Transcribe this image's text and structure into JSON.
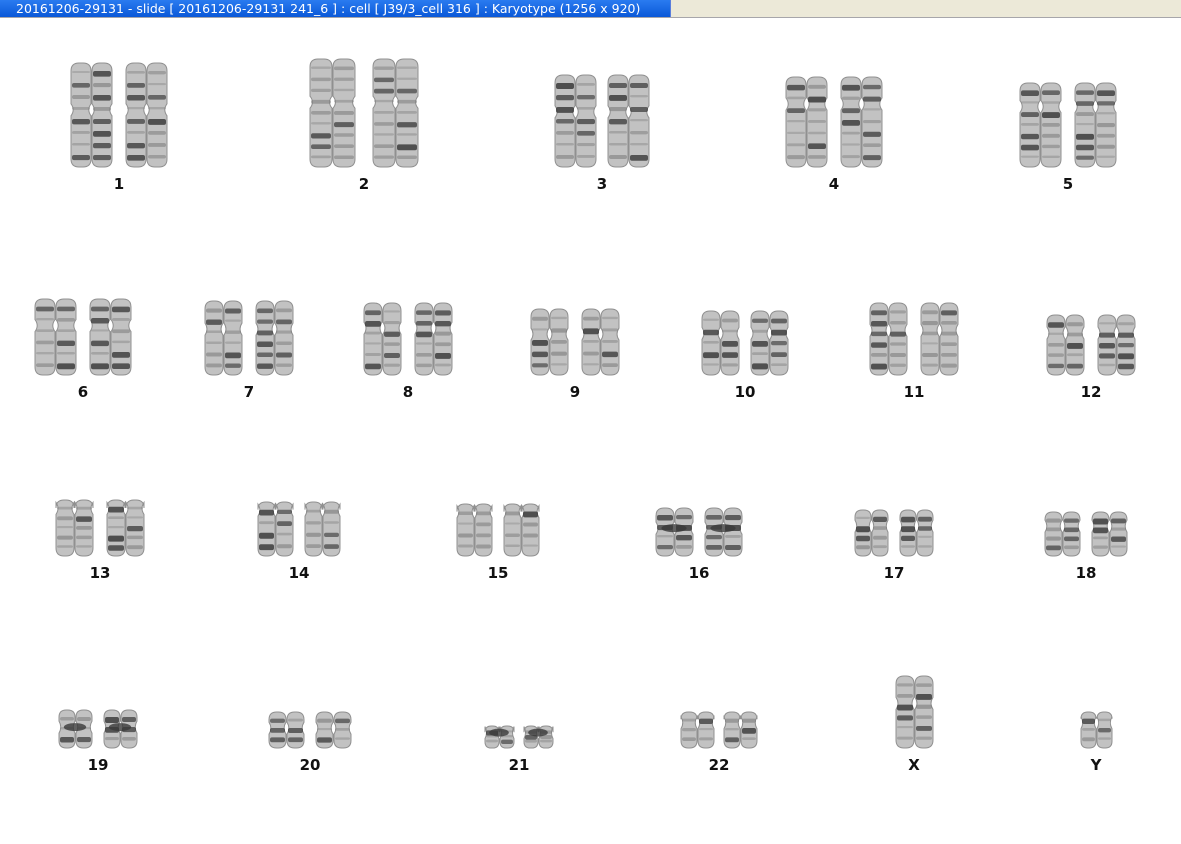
{
  "window": {
    "title": "20161206-29131 - slide [ 20161206-29131 241_6 ] : cell [ J39/3_cell 316 ] : Karyotype  (1256 x 920)"
  },
  "karyotype": {
    "chromosome_labels": [
      "1",
      "2",
      "3",
      "4",
      "5",
      "6",
      "7",
      "8",
      "9",
      "10",
      "11",
      "12",
      "13",
      "14",
      "15",
      "16",
      "17",
      "18",
      "19",
      "20",
      "21",
      "22",
      "X",
      "Y"
    ],
    "colors": {
      "chromatin_dark": "#3a3a3a",
      "chromatin_mid": "#7d7d7d",
      "chromatin_light": "#b8b8b8",
      "title_bar": "#0a58d8"
    }
  }
}
